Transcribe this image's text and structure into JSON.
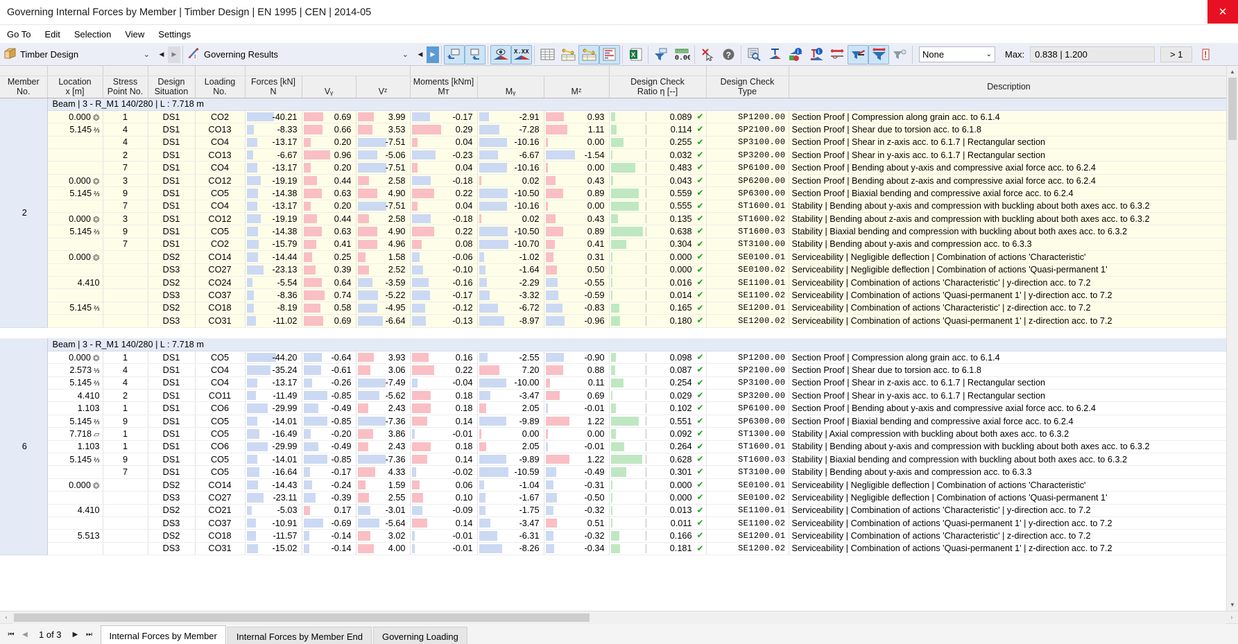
{
  "window": {
    "title": "Governing Internal Forces by Member | Timber Design | EN 1995 | CEN | 2014-05",
    "close_label": "✕"
  },
  "menu": {
    "items": [
      "Go To",
      "Edit",
      "Selection",
      "View",
      "Settings"
    ]
  },
  "toolbar": {
    "module_combo": {
      "value": "Timber Design",
      "chevron": "⌄"
    },
    "results_combo": {
      "value": "Governing Results",
      "chevron": "⌄"
    },
    "prev_label": "◀",
    "next_label": "▶",
    "filter_combo": {
      "value": "None",
      "chevron": "⌄"
    },
    "max_label": "Max:",
    "max_value": "0.838 | 1.200",
    "gt_label": "> 1",
    "icons": [
      "navigate-back-icon",
      "navigate-forward-icon",
      "show-results-icon",
      "decimal-places-icon",
      "table-icon",
      "table-export-icon",
      "table-chart-icon",
      "diagram-icon",
      "excel-export-icon",
      "filter-results-icon",
      "decimal-zero-icon",
      "deselect-icon",
      "help-icon",
      "find-icon",
      "section-icon",
      "info-blue-icon",
      "info-member-icon",
      "support-icon",
      "filter-down-icon",
      "filter-design-icon",
      "filter-clear-icon"
    ]
  },
  "table": {
    "group_headers": [
      {
        "label": "",
        "span": 1
      },
      {
        "label": "",
        "span": 1
      },
      {
        "label": "",
        "span": 1
      },
      {
        "label": "",
        "span": 1
      },
      {
        "label": "",
        "span": 1
      },
      {
        "label": "Forces [kN]",
        "span": 3
      },
      {
        "label": "Moments [kNm]",
        "span": 3
      },
      {
        "label": "",
        "span": 1
      },
      {
        "label": "",
        "span": 1
      },
      {
        "label": "",
        "span": 1
      }
    ],
    "columns": [
      {
        "l1": "Member",
        "l2": "No."
      },
      {
        "l1": "Location",
        "l2": "x [m]"
      },
      {
        "l1": "Stress",
        "l2": "Point No."
      },
      {
        "l1": "Design",
        "l2": "Situation"
      },
      {
        "l1": "Loading",
        "l2": "No."
      },
      {
        "l1": "",
        "l2": "N"
      },
      {
        "l1": "",
        "l2": "Vᵧ"
      },
      {
        "l1": "",
        "l2": "Vᶻ"
      },
      {
        "l1": "",
        "l2": "Mᴛ"
      },
      {
        "l1": "",
        "l2": "Mᵧ"
      },
      {
        "l1": "",
        "l2": "Mᶻ"
      },
      {
        "l1": "Design Check",
        "l2": "Ratio η [--]"
      },
      {
        "l1": "Design Check",
        "l2": "Type"
      },
      {
        "l1": "Description",
        "l2": ""
      }
    ],
    "groups": [
      {
        "member_no": "2",
        "band": "yellow",
        "header": "Beam | 3 - R_M1 140/280 | L : 7.718 m",
        "rows": [
          {
            "x": "0.000",
            "sym": "support",
            "frac": "",
            "sp": "1",
            "ds": "DS1",
            "co": "CO2",
            "n": "-40.21",
            "vy": "0.69",
            "vz": "3.99",
            "mt": "-0.17",
            "my": "-2.91",
            "mz": "0.93",
            "ratio": "0.089",
            "type": "SP1200.00",
            "desc": "Section Proof | Compression along grain acc. to 6.1.4"
          },
          {
            "x": "5.145",
            "sym": "",
            "frac": "2/3",
            "sp": "4",
            "ds": "DS1",
            "co": "CO13",
            "n": "-8.33",
            "vy": "0.66",
            "vz": "3.53",
            "mt": "0.29",
            "my": "-7.28",
            "mz": "1.11",
            "ratio": "0.114",
            "type": "SP2100.00",
            "desc": "Section Proof | Shear due to torsion acc. to 6.1.8"
          },
          {
            "x": "",
            "sym": "",
            "frac": "",
            "sp": "4",
            "ds": "DS1",
            "co": "CO4",
            "n": "-13.17",
            "vy": "0.20",
            "vz": "-7.51",
            "mt": "0.04",
            "my": "-10.16",
            "mz": "0.00",
            "ratio": "0.255",
            "type": "SP3100.00",
            "desc": "Section Proof | Shear in z-axis acc. to 6.1.7 | Rectangular section"
          },
          {
            "x": "",
            "sym": "",
            "frac": "",
            "sp": "2",
            "ds": "DS1",
            "co": "CO13",
            "n": "-6.67",
            "vy": "0.96",
            "vz": "-5.06",
            "mt": "-0.23",
            "my": "-6.67",
            "mz": "-1.54",
            "ratio": "0.032",
            "type": "SP3200.00",
            "desc": "Section Proof | Shear in y-axis acc. to 6.1.7 | Rectangular section"
          },
          {
            "x": "",
            "sym": "",
            "frac": "",
            "sp": "7",
            "ds": "DS1",
            "co": "CO4",
            "n": "-13.17",
            "vy": "0.20",
            "vz": "-7.51",
            "mt": "0.04",
            "my": "-10.16",
            "mz": "0.00",
            "ratio": "0.483",
            "type": "SP6100.00",
            "desc": "Section Proof | Bending about y-axis and compressive axial force acc. to 6.2.4"
          },
          {
            "x": "0.000",
            "sym": "support",
            "frac": "",
            "sp": "3",
            "ds": "DS1",
            "co": "CO12",
            "n": "-19.19",
            "vy": "0.44",
            "vz": "2.58",
            "mt": "-0.18",
            "my": "0.02",
            "mz": "0.43",
            "ratio": "0.043",
            "type": "SP6200.00",
            "desc": "Section Proof | Bending about z-axis and compressive axial force acc. to 6.2.4"
          },
          {
            "x": "5.145",
            "sym": "",
            "frac": "2/3",
            "sp": "9",
            "ds": "DS1",
            "co": "CO5",
            "n": "-14.38",
            "vy": "0.63",
            "vz": "4.90",
            "mt": "0.22",
            "my": "-10.50",
            "mz": "0.89",
            "ratio": "0.559",
            "type": "SP6300.00",
            "desc": "Section Proof | Biaxial bending and compressive axial force acc. to 6.2.4"
          },
          {
            "x": "",
            "sym": "",
            "frac": "",
            "sp": "7",
            "ds": "DS1",
            "co": "CO4",
            "n": "-13.17",
            "vy": "0.20",
            "vz": "-7.51",
            "mt": "0.04",
            "my": "-10.16",
            "mz": "0.00",
            "ratio": "0.555",
            "type": "ST1600.01",
            "desc": "Stability | Bending about y-axis and compression with buckling about both axes acc. to 6.3.2"
          },
          {
            "x": "0.000",
            "sym": "support",
            "frac": "",
            "sp": "3",
            "ds": "DS1",
            "co": "CO12",
            "n": "-19.19",
            "vy": "0.44",
            "vz": "2.58",
            "mt": "-0.18",
            "my": "0.02",
            "mz": "0.43",
            "ratio": "0.135",
            "type": "ST1600.02",
            "desc": "Stability | Bending about z-axis and compression with buckling about both axes acc. to 6.3.2"
          },
          {
            "x": "5.145",
            "sym": "",
            "frac": "2/3",
            "sp": "9",
            "ds": "DS1",
            "co": "CO5",
            "n": "-14.38",
            "vy": "0.63",
            "vz": "4.90",
            "mt": "0.22",
            "my": "-10.50",
            "mz": "0.89",
            "ratio": "0.638",
            "type": "ST1600.03",
            "desc": "Stability | Biaxial bending and compression with buckling about both axes acc. to 6.3.2"
          },
          {
            "x": "",
            "sym": "",
            "frac": "",
            "sp": "7",
            "ds": "DS1",
            "co": "CO2",
            "n": "-15.79",
            "vy": "0.41",
            "vz": "4.96",
            "mt": "0.08",
            "my": "-10.70",
            "mz": "0.41",
            "ratio": "0.304",
            "type": "ST3100.00",
            "desc": "Stability | Bending about y-axis and compression acc. to 6.3.3"
          },
          {
            "x": "0.000",
            "sym": "support",
            "frac": "",
            "sp": "",
            "ds": "DS2",
            "co": "CO14",
            "n": "-14.44",
            "vy": "0.25",
            "vz": "1.58",
            "mt": "-0.06",
            "my": "-1.02",
            "mz": "0.31",
            "ratio": "0.000",
            "type": "SE0100.01",
            "desc": "Serviceability | Negligible deflection | Combination of actions 'Characteristic'"
          },
          {
            "x": "",
            "sym": "",
            "frac": "",
            "sp": "",
            "ds": "DS3",
            "co": "CO27",
            "n": "-23.13",
            "vy": "0.39",
            "vz": "2.52",
            "mt": "-0.10",
            "my": "-1.64",
            "mz": "0.50",
            "ratio": "0.000",
            "type": "SE0100.02",
            "desc": "Serviceability | Negligible deflection | Combination of actions 'Quasi-permanent 1'"
          },
          {
            "x": "4.410",
            "sym": "",
            "frac": "",
            "sp": "",
            "ds": "DS2",
            "co": "CO24",
            "n": "-5.54",
            "vy": "0.64",
            "vz": "-3.59",
            "mt": "-0.16",
            "my": "-2.29",
            "mz": "-0.55",
            "ratio": "0.016",
            "type": "SE1100.01",
            "desc": "Serviceability | Combination of actions 'Characteristic' | y-direction acc. to 7.2"
          },
          {
            "x": "",
            "sym": "",
            "frac": "",
            "sp": "",
            "ds": "DS3",
            "co": "CO37",
            "n": "-8.36",
            "vy": "0.74",
            "vz": "-5.22",
            "mt": "-0.17",
            "my": "-3.32",
            "mz": "-0.59",
            "ratio": "0.014",
            "type": "SE1100.02",
            "desc": "Serviceability | Combination of actions 'Quasi-permanent 1' | y-direction acc. to 7.2"
          },
          {
            "x": "5.145",
            "sym": "",
            "frac": "2/3",
            "sp": "",
            "ds": "DS2",
            "co": "CO18",
            "n": "-8.19",
            "vy": "0.58",
            "vz": "-4.95",
            "mt": "-0.12",
            "my": "-6.72",
            "mz": "-0.83",
            "ratio": "0.165",
            "type": "SE1200.01",
            "desc": "Serviceability | Combination of actions 'Characteristic' | z-direction acc. to 7.2"
          },
          {
            "x": "",
            "sym": "",
            "frac": "",
            "sp": "",
            "ds": "DS3",
            "co": "CO31",
            "n": "-11.02",
            "vy": "0.69",
            "vz": "-6.64",
            "mt": "-0.13",
            "my": "-8.97",
            "mz": "-0.96",
            "ratio": "0.180",
            "type": "SE1200.02",
            "desc": "Serviceability | Combination of actions 'Quasi-permanent 1' | z-direction acc. to 7.2"
          }
        ]
      },
      {
        "member_no": "6",
        "band": "white",
        "header": "Beam | 3 - R_M1 140/280 | L : 7.718 m",
        "rows": [
          {
            "x": "0.000",
            "sym": "support",
            "frac": "",
            "sp": "1",
            "ds": "DS1",
            "co": "CO5",
            "n": "-44.20",
            "vy": "-0.64",
            "vz": "3.93",
            "mt": "0.16",
            "my": "-2.55",
            "mz": "-0.90",
            "ratio": "0.098",
            "type": "SP1200.00",
            "desc": "Section Proof | Compression along grain acc. to 6.1.4"
          },
          {
            "x": "2.573",
            "sym": "",
            "frac": "1/3",
            "sp": "4",
            "ds": "DS1",
            "co": "CO4",
            "n": "-35.24",
            "vy": "-0.61",
            "vz": "3.06",
            "mt": "0.22",
            "my": "7.20",
            "mz": "0.88",
            "ratio": "0.087",
            "type": "SP2100.00",
            "desc": "Section Proof | Shear due to torsion acc. to 6.1.8"
          },
          {
            "x": "5.145",
            "sym": "",
            "frac": "2/3",
            "sp": "4",
            "ds": "DS1",
            "co": "CO4",
            "n": "-13.17",
            "vy": "-0.26",
            "vz": "-7.49",
            "mt": "-0.04",
            "my": "-10.00",
            "mz": "0.11",
            "ratio": "0.254",
            "type": "SP3100.00",
            "desc": "Section Proof | Shear in z-axis acc. to 6.1.7 | Rectangular section"
          },
          {
            "x": "4.410",
            "sym": "",
            "frac": "",
            "sp": "2",
            "ds": "DS1",
            "co": "CO11",
            "n": "-11.49",
            "vy": "-0.85",
            "vz": "-5.62",
            "mt": "0.18",
            "my": "-3.47",
            "mz": "0.69",
            "ratio": "0.029",
            "type": "SP3200.00",
            "desc": "Section Proof | Shear in y-axis acc. to 6.1.7 | Rectangular section"
          },
          {
            "x": "1.103",
            "sym": "",
            "frac": "",
            "sp": "1",
            "ds": "DS1",
            "co": "CO6",
            "n": "-29.99",
            "vy": "-0.49",
            "vz": "2.43",
            "mt": "0.18",
            "my": "2.05",
            "mz": "-0.01",
            "ratio": "0.102",
            "type": "SP6100.00",
            "desc": "Section Proof | Bending about y-axis and compressive axial force acc. to 6.2.4"
          },
          {
            "x": "5.145",
            "sym": "",
            "frac": "2/3",
            "sp": "9",
            "ds": "DS1",
            "co": "CO5",
            "n": "-14.01",
            "vy": "-0.85",
            "vz": "-7.36",
            "mt": "0.14",
            "my": "-9.89",
            "mz": "1.22",
            "ratio": "0.551",
            "type": "SP6300.00",
            "desc": "Section Proof | Biaxial bending and compressive axial force acc. to 6.2.4"
          },
          {
            "x": "7.718",
            "sym": "support2",
            "frac": "",
            "sp": "1",
            "ds": "DS1",
            "co": "CO5",
            "n": "-16.49",
            "vy": "-0.20",
            "vz": "3.86",
            "mt": "-0.01",
            "my": "0.00",
            "mz": "0.00",
            "ratio": "0.092",
            "type": "ST1300.00",
            "desc": "Stability | Axial compression with buckling about both axes acc. to 6.3.2"
          },
          {
            "x": "1.103",
            "sym": "",
            "frac": "",
            "sp": "1",
            "ds": "DS1",
            "co": "CO6",
            "n": "-29.99",
            "vy": "-0.49",
            "vz": "2.43",
            "mt": "0.18",
            "my": "2.05",
            "mz": "-0.01",
            "ratio": "0.264",
            "type": "ST1600.01",
            "desc": "Stability | Bending about y-axis and compression with buckling about both axes acc. to 6.3.2"
          },
          {
            "x": "5.145",
            "sym": "",
            "frac": "2/3",
            "sp": "9",
            "ds": "DS1",
            "co": "CO5",
            "n": "-14.01",
            "vy": "-0.85",
            "vz": "-7.36",
            "mt": "0.14",
            "my": "-9.89",
            "mz": "1.22",
            "ratio": "0.628",
            "type": "ST1600.03",
            "desc": "Stability | Biaxial bending and compression with buckling about both axes acc. to 6.3.2"
          },
          {
            "x": "",
            "sym": "",
            "frac": "",
            "sp": "7",
            "ds": "DS1",
            "co": "CO5",
            "n": "-16.64",
            "vy": "-0.17",
            "vz": "4.33",
            "mt": "-0.02",
            "my": "-10.59",
            "mz": "-0.49",
            "ratio": "0.301",
            "type": "ST3100.00",
            "desc": "Stability | Bending about y-axis and compression acc. to 6.3.3"
          },
          {
            "x": "0.000",
            "sym": "support",
            "frac": "",
            "sp": "",
            "ds": "DS2",
            "co": "CO14",
            "n": "-14.43",
            "vy": "-0.24",
            "vz": "1.59",
            "mt": "0.06",
            "my": "-1.04",
            "mz": "-0.31",
            "ratio": "0.000",
            "type": "SE0100.01",
            "desc": "Serviceability | Negligible deflection | Combination of actions 'Characteristic'"
          },
          {
            "x": "",
            "sym": "",
            "frac": "",
            "sp": "",
            "ds": "DS3",
            "co": "CO27",
            "n": "-23.11",
            "vy": "-0.39",
            "vz": "2.55",
            "mt": "0.10",
            "my": "-1.67",
            "mz": "-0.50",
            "ratio": "0.000",
            "type": "SE0100.02",
            "desc": "Serviceability | Negligible deflection | Combination of actions 'Quasi-permanent 1'"
          },
          {
            "x": "4.410",
            "sym": "",
            "frac": "",
            "sp": "",
            "ds": "DS2",
            "co": "CO21",
            "n": "-5.03",
            "vy": "0.17",
            "vz": "-3.01",
            "mt": "-0.09",
            "my": "-1.75",
            "mz": "-0.32",
            "ratio": "0.013",
            "type": "SE1100.01",
            "desc": "Serviceability | Combination of actions 'Characteristic' | y-direction acc. to 7.2"
          },
          {
            "x": "",
            "sym": "",
            "frac": "",
            "sp": "",
            "ds": "DS3",
            "co": "CO37",
            "n": "-10.91",
            "vy": "-0.69",
            "vz": "-5.64",
            "mt": "0.14",
            "my": "-3.47",
            "mz": "0.51",
            "ratio": "0.011",
            "type": "SE1100.02",
            "desc": "Serviceability | Combination of actions 'Quasi-permanent 1' | y-direction acc. to 7.2"
          },
          {
            "x": "5.513",
            "sym": "",
            "frac": "",
            "sp": "",
            "ds": "DS2",
            "co": "CO18",
            "n": "-11.57",
            "vy": "-0.14",
            "vz": "3.02",
            "mt": "-0.01",
            "my": "-6.31",
            "mz": "-0.32",
            "ratio": "0.166",
            "type": "SE1200.01",
            "desc": "Serviceability | Combination of actions 'Characteristic' | z-direction acc. to 7.2"
          },
          {
            "x": "",
            "sym": "",
            "frac": "",
            "sp": "",
            "ds": "DS3",
            "co": "CO31",
            "n": "-15.02",
            "vy": "-0.14",
            "vz": "4.00",
            "mt": "-0.01",
            "my": "-8.26",
            "mz": "-0.34",
            "ratio": "0.181",
            "type": "SE1200.02",
            "desc": "Serviceability | Combination of actions 'Quasi-permanent 1' | z-direction acc. to 7.2"
          }
        ]
      }
    ]
  },
  "statusbar": {
    "first_label": "⏮",
    "prev_label": "◀",
    "page_info": "1 of 3",
    "next_label": "▶",
    "last_label": "⏭",
    "tabs": [
      {
        "label": "Internal Forces by Member",
        "active": true
      },
      {
        "label": "Internal Forces by Member End",
        "active": false
      },
      {
        "label": "Governing Loading",
        "active": false
      }
    ]
  },
  "scroll": {
    "left_arrow": "‹",
    "right_arrow": "›",
    "up_arrow": "▲",
    "down_arrow": "▼"
  }
}
